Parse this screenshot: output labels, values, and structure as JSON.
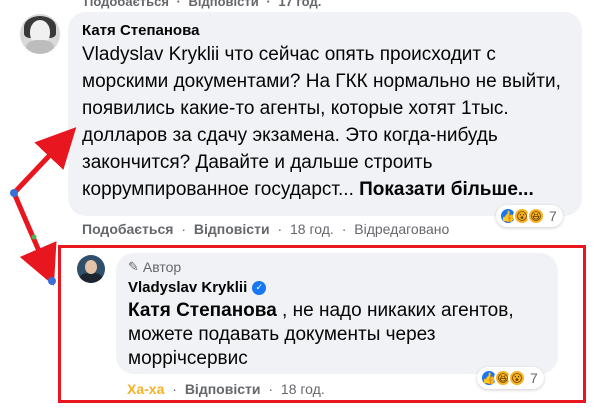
{
  "top_row": {
    "like": "Подобається",
    "sep": "·",
    "reply": "Відповісти",
    "time": "17 год."
  },
  "comment": {
    "author": "Катя Степанова",
    "text": "Vladyslav Kryklii что сейчас опять происходит с морскими документами? На ГКК нормально не выйти, появились какие-то агенты, которые хотят 1тыс. долларов за сдачу экзамена. Это когда-нибудь закончится? Давайте и дальше строить коррумпированное государст... ",
    "see_more": "Показати більше...",
    "actions": {
      "like": "Подобається",
      "reply": "Відповісти",
      "time": "18 год.",
      "edited": "Відредаговано",
      "sep": "·"
    },
    "reactions": {
      "count": "7",
      "icons": [
        "like-icon",
        "wow-icon",
        "haha-icon"
      ]
    }
  },
  "reply": {
    "badge": "Автор",
    "author": "Vladyslav Kryklii",
    "mention": "Катя Степанова",
    "text": " , не надо никаких агентов, можете подавать документы через моррічсервис",
    "actions": {
      "reaction": "Ха-ха",
      "reply": "Відповісти",
      "time": "18 год.",
      "sep": "·"
    },
    "reactions": {
      "count": "7",
      "icons": [
        "like-icon",
        "haha-icon",
        "wow-icon"
      ]
    }
  },
  "colors": {
    "annotation_red": "#e8171f",
    "bubble_bg": "#f0f2f5",
    "meta_gray": "#65676b",
    "haha_yellow": "#f7b125",
    "fb_blue": "#1877f2"
  }
}
